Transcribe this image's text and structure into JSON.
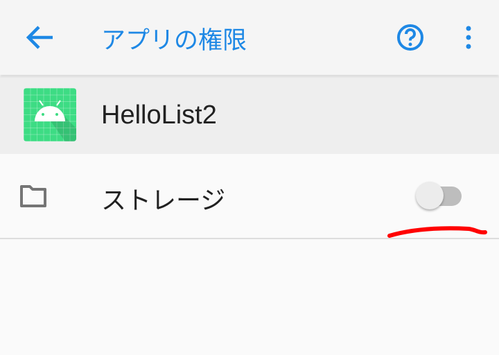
{
  "appbar": {
    "title": "アプリの権限"
  },
  "app": {
    "name": "HelloList2"
  },
  "permissions": [
    {
      "label": "ストレージ",
      "enabled": false
    }
  ],
  "colors": {
    "accent": "#1e88e5",
    "annotation": "#ff0000"
  }
}
